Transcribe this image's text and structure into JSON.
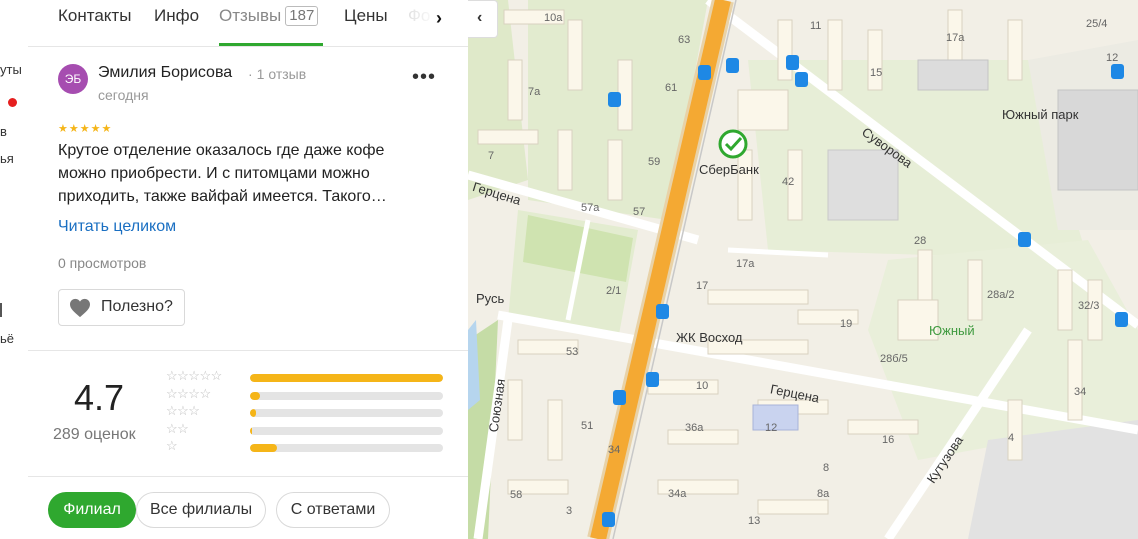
{
  "left_strip": {
    "text1": "уты",
    "text2": "в",
    "text3": "ья",
    "text4": "ьё"
  },
  "tabs": [
    {
      "label": "Контакты"
    },
    {
      "label": "Инфо"
    },
    {
      "label": "Отзывы",
      "count": "187"
    },
    {
      "label": "Цены"
    },
    {
      "label": "Фо"
    }
  ],
  "review": {
    "avatar_initials": "ЭБ",
    "author": "Эмилия Борисова",
    "author_reviews": "1 отзыв",
    "date": "сегодня",
    "stars": "★★★★★",
    "text": "Крутое отделение оказалось где даже кофе можно приобрести. И с питомцами можно приходить, также вайфай имеется. Такого…",
    "read_more": "Читать целиком",
    "views": "0 просмотров",
    "helpful_label": "Полезно?"
  },
  "rating": {
    "value": "4.7",
    "count_label": "289 оценок",
    "distribution": [
      {
        "stars": "★★★★★",
        "fraction": 1.0
      },
      {
        "stars": "★★★★",
        "fraction": 0.05
      },
      {
        "stars": "★★★",
        "fraction": 0.03
      },
      {
        "stars": "★★",
        "fraction": 0.01
      },
      {
        "stars": "★",
        "fraction": 0.14
      }
    ]
  },
  "filters": [
    {
      "label": "Филиал",
      "active": true
    },
    {
      "label": "Все филиалы",
      "active": false
    },
    {
      "label": "С ответами",
      "active": false
    }
  ],
  "map": {
    "streets": [
      "Герцена",
      "Герцена",
      "Суворова",
      "Союзная",
      "Кутузова"
    ],
    "pois": [
      "СберБанк",
      "Южный парк",
      "ЖК Восход",
      "Русь"
    ],
    "districts": [
      "Южный"
    ],
    "houses": [
      "10а",
      "63",
      "11",
      "17а",
      "25/4",
      "7а",
      "61",
      "15",
      "12",
      "7",
      "59",
      "42",
      "57а",
      "57",
      "28",
      "17а",
      "17",
      "2/1",
      "28а/2",
      "32/3",
      "19",
      "28б/5",
      "53",
      "10",
      "34",
      "12",
      "16",
      "51",
      "36а",
      "4",
      "34",
      "8",
      "58",
      "34а",
      "8а",
      "3",
      "13"
    ]
  },
  "colors": {
    "accent_green": "#2fa82f",
    "star_yellow": "#f5b518",
    "link_blue": "#1a6fc2",
    "avatar_purple": "#a64db0",
    "road_orange": "#f4a933"
  }
}
